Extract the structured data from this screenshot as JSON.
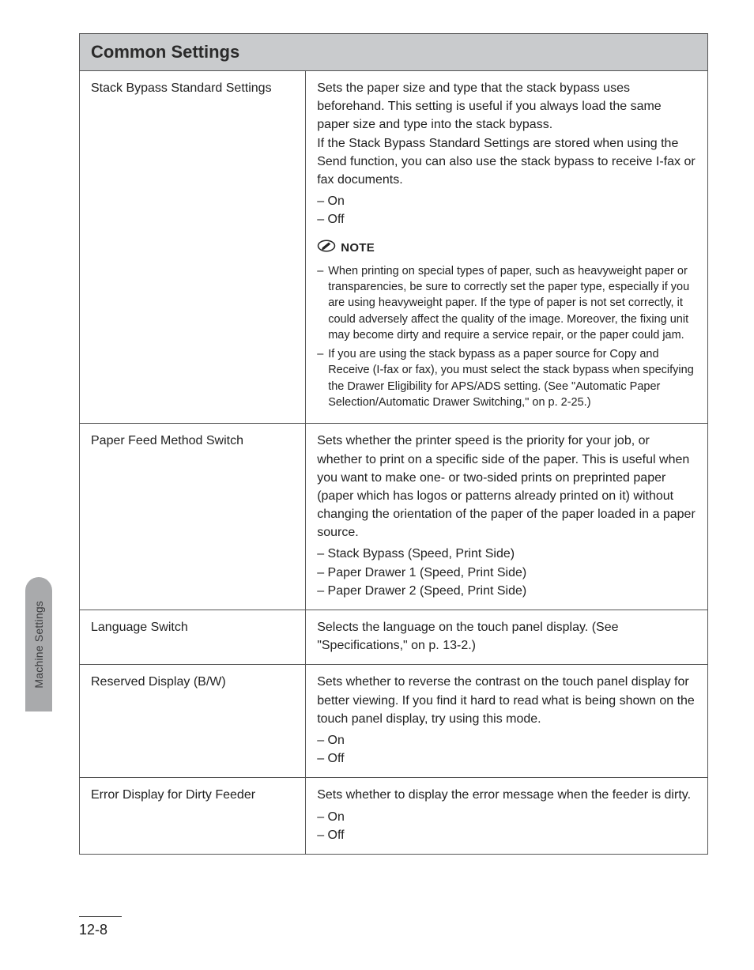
{
  "sidebar": {
    "label": "Machine Settings"
  },
  "table": {
    "header": "Common Settings",
    "rows": [
      {
        "name": "Stack Bypass Standard Settings",
        "desc": "Sets the paper size and type that the stack bypass uses beforehand. This setting is useful if you always load the same paper size and type into the stack bypass.\nIf the Stack Bypass Standard Settings are stored when using the Send function, you can also use the stack bypass to receive I-fax or fax documents.",
        "opts": [
          "On",
          "Off"
        ],
        "note_label": "NOTE",
        "notes": [
          "When printing on special types of paper, such as heavyweight paper or transparencies, be sure to correctly set the paper type, especially if you are using heavyweight paper. If the type of paper is not set correctly, it could adversely affect the quality of the image. Moreover, the fixing unit may become dirty and require a service repair, or the paper could jam.",
          "If you are using the stack bypass as a paper source for Copy and Receive (I-fax or fax), you must select the stack bypass when specifying the Drawer Eligibility for APS/ADS setting. (See \"Automatic Paper Selection/Automatic Drawer Switching,\" on p. 2-25.)"
        ]
      },
      {
        "name": "Paper Feed Method Switch",
        "desc": "Sets whether the printer speed is the priority for your job, or whether to print on a specific side of the paper. This is useful when you want to make one- or two-sided prints on preprinted paper (paper which has logos or patterns already printed on it) without changing the orientation of the paper of the paper loaded in a paper source.",
        "opts": [
          "Stack Bypass (Speed, Print Side)",
          "Paper Drawer 1 (Speed, Print Side)",
          "Paper Drawer 2 (Speed, Print Side)"
        ]
      },
      {
        "name": "Language Switch",
        "desc": "Selects the language on the touch panel display. (See \"Specifications,\" on p. 13-2.)"
      },
      {
        "name": "Reserved Display (B/W)",
        "desc": "Sets whether to reverse the contrast on the touch panel display for better viewing. If you find it hard to read what is being shown on the touch panel display, try using this mode.",
        "opts": [
          "On",
          "Off"
        ]
      },
      {
        "name": "Error Display for Dirty Feeder",
        "desc": "Sets whether to display the error message when the feeder is dirty.",
        "opts": [
          "On",
          "Off"
        ]
      }
    ]
  },
  "page_number": "12-8"
}
